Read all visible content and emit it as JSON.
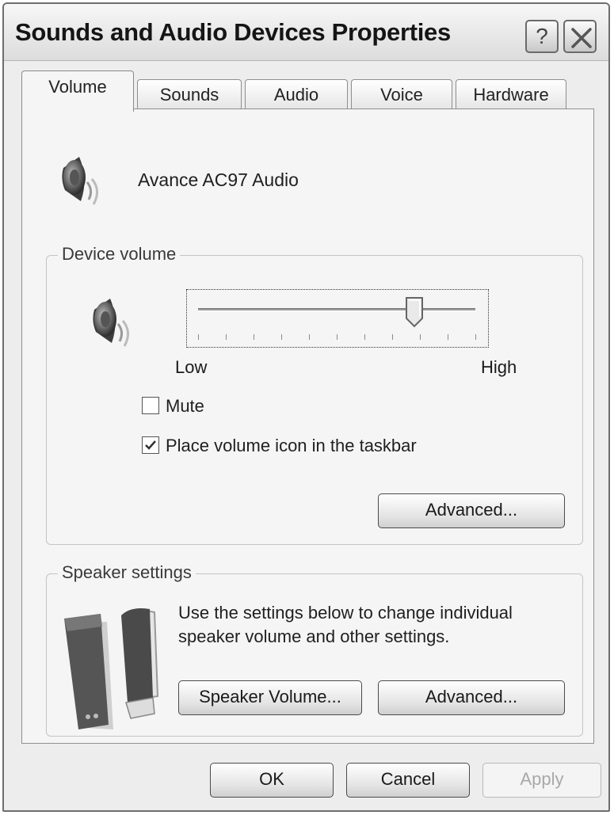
{
  "window": {
    "title": "Sounds and Audio Devices Properties",
    "help_label": "?"
  },
  "tabs": [
    {
      "label": "Volume",
      "active": true
    },
    {
      "label": "Sounds",
      "active": false
    },
    {
      "label": "Audio",
      "active": false
    },
    {
      "label": "Voice",
      "active": false
    },
    {
      "label": "Hardware",
      "active": false
    }
  ],
  "device": {
    "name": "Avance AC97 Audio",
    "icon": "speaker-icon"
  },
  "device_volume": {
    "group_label": "Device volume",
    "low_label": "Low",
    "high_label": "High",
    "level": 0.78,
    "tick_count": 11,
    "mute_label": "Mute",
    "mute_checked": false,
    "taskbar_label": "Place volume icon in the taskbar",
    "taskbar_checked": true,
    "advanced_label": "Advanced..."
  },
  "speaker_settings": {
    "group_label": "Speaker settings",
    "description_line1": "Use the settings below to change individual",
    "description_line2": "speaker volume and other settings.",
    "speaker_volume_label": "Speaker Volume...",
    "advanced_label": "Advanced..."
  },
  "footer": {
    "ok_label": "OK",
    "cancel_label": "Cancel",
    "apply_label": "Apply",
    "apply_enabled": false
  },
  "colors": {
    "window_bg": "#ededed",
    "panel_bg": "#f5f5f5",
    "border": "#8f8f8f",
    "disabled_text": "#a8a8a8"
  }
}
